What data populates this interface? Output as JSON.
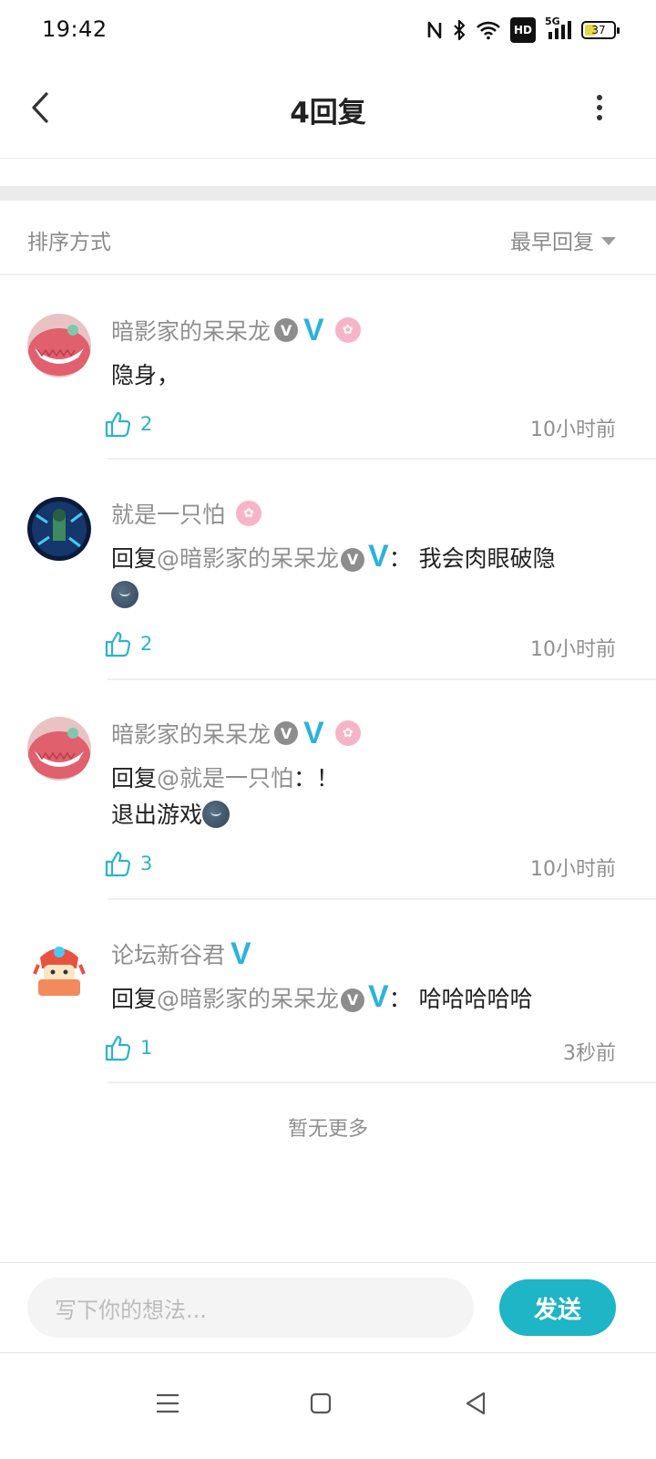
{
  "status_bar": {
    "time": "19:42",
    "network": "5G",
    "hd_label": "HD",
    "battery": "37",
    "icons": [
      "nfc-icon",
      "bluetooth-icon",
      "wifi-icon",
      "hd-icon",
      "signal-icon",
      "battery-icon"
    ]
  },
  "header": {
    "title": "4回复",
    "back_icon": "chevron-left-icon",
    "more_icon": "more-vertical-icon"
  },
  "sort": {
    "label": "排序方式",
    "selected": "最早回复"
  },
  "replies": [
    {
      "username": "暗影家的呆呆龙",
      "badge_v": "V",
      "badge_v_blue": "V",
      "content": "隐身，",
      "likes": "2",
      "time": "10小时前"
    },
    {
      "username": "就是一只怕",
      "content_prefix": "回复",
      "mention": "@暗影家的呆呆龙",
      "badge_v": "V",
      "badge_v_blue": "V",
      "content_suffix": "： 我会肉眼破隐",
      "likes": "2",
      "time": "10小时前"
    },
    {
      "username": "暗影家的呆呆龙",
      "badge_v": "V",
      "badge_v_blue": "V",
      "content_prefix": "回复",
      "mention": "@就是一只怕",
      "content_suffix": "：！",
      "content_line2": "退出游戏",
      "likes": "3",
      "time": "10小时前"
    },
    {
      "username": "论坛新谷君",
      "badge_v_blue": "V",
      "content_prefix": "回复",
      "mention": "@暗影家的呆呆龙",
      "badge_v": "V",
      "content_suffix": "： 哈哈哈哈哈",
      "likes": "1",
      "time": "3秒前"
    }
  ],
  "footer_text": "暂无更多",
  "composer": {
    "placeholder": "写下你的想法...",
    "send_label": "发送"
  },
  "colors": {
    "accent": "#1eb5c6",
    "verified_blue": "#2bb3dd",
    "muted_text": "#8f8f8f",
    "level_badge": "#f7b4c9"
  }
}
